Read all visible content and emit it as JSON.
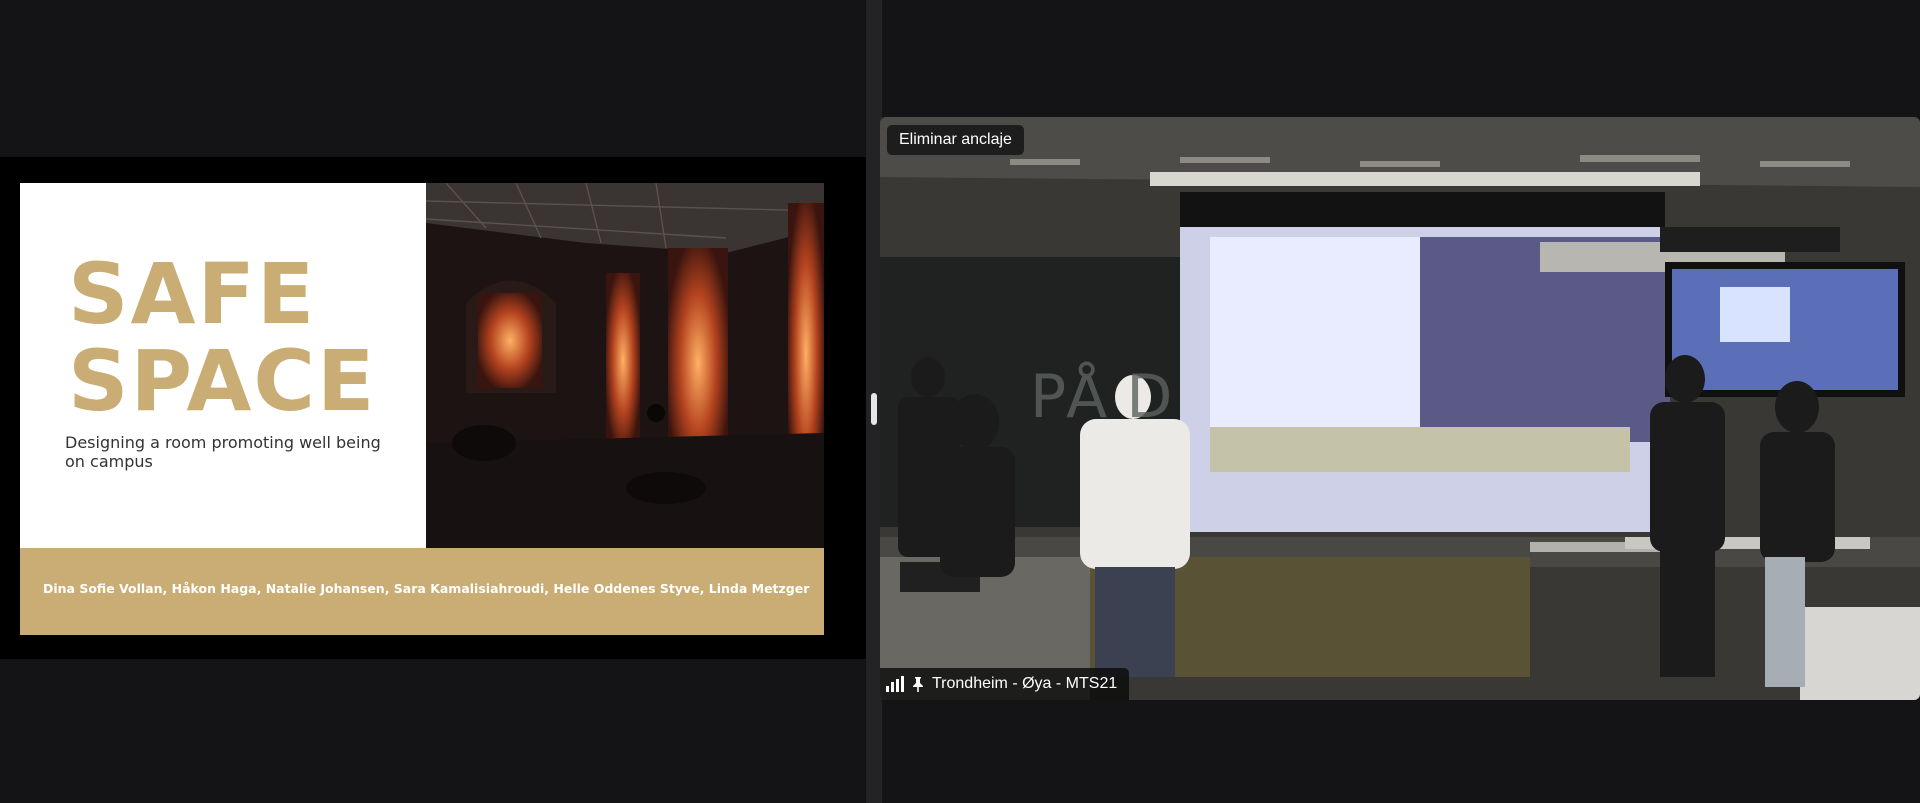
{
  "shared_screen": {
    "slide": {
      "title_line1": "SAFE",
      "title_line2": "SPACE",
      "subtitle": "Designing a room promoting well being on campus",
      "authors": "Dina Sofie Vollan, Håkon Haga, Natalie Johansen, Sara Kamalisiahroudi, Helle Oddenes Styve, Linda Metzger"
    },
    "colors": {
      "accent_gold": "#c9ad74",
      "slide_bg": "#ffffff"
    }
  },
  "video_feed": {
    "unpin_label": "Eliminar anclaje",
    "room_name": "Trondheim - Øya - MTS21",
    "signal_icon": "signal-strength-icon",
    "pin_icon": "pin-icon"
  }
}
